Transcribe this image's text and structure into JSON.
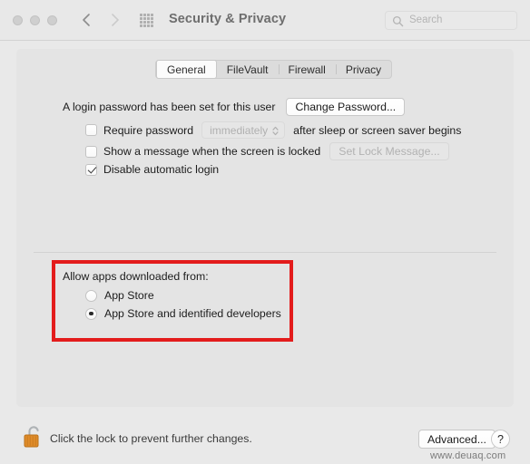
{
  "window": {
    "title": "Security & Privacy",
    "traffic_lights": [
      "close",
      "minimize",
      "zoom"
    ]
  },
  "toolbar": {
    "back_icon": "chevron-left-icon",
    "forward_icon": "chevron-right-icon",
    "grid_icon": "show-all-grid-icon",
    "search": {
      "icon": "search-icon",
      "placeholder": "Search",
      "value": ""
    }
  },
  "tabs": [
    {
      "label": "General",
      "active": true
    },
    {
      "label": "FileVault",
      "active": false
    },
    {
      "label": "Firewall",
      "active": false
    },
    {
      "label": "Privacy",
      "active": false
    }
  ],
  "general": {
    "password_status": "A login password has been set for this user",
    "change_password_label": "Change Password...",
    "require_password": {
      "label": "Require password",
      "checked": false,
      "popup_value": "immediately",
      "suffix": "after sleep or screen saver begins",
      "enabled": false
    },
    "lock_message": {
      "label": "Show a message when the screen is locked",
      "checked": false,
      "button_label": "Set Lock Message...",
      "enabled": false
    },
    "disable_auto_login": {
      "label": "Disable automatic login",
      "checked": true
    }
  },
  "gatekeeper": {
    "heading": "Allow apps downloaded from:",
    "options": [
      {
        "label": "App Store",
        "selected": false
      },
      {
        "label": "App Store and identified developers",
        "selected": true
      }
    ],
    "highlight_color": "#e31c1c"
  },
  "footer": {
    "lock_icon": "unlocked-padlock-icon",
    "lock_text": "Click the lock to prevent further changes.",
    "advanced_label": "Advanced...",
    "help_label": "?"
  },
  "watermark": "www.deuaq.com"
}
